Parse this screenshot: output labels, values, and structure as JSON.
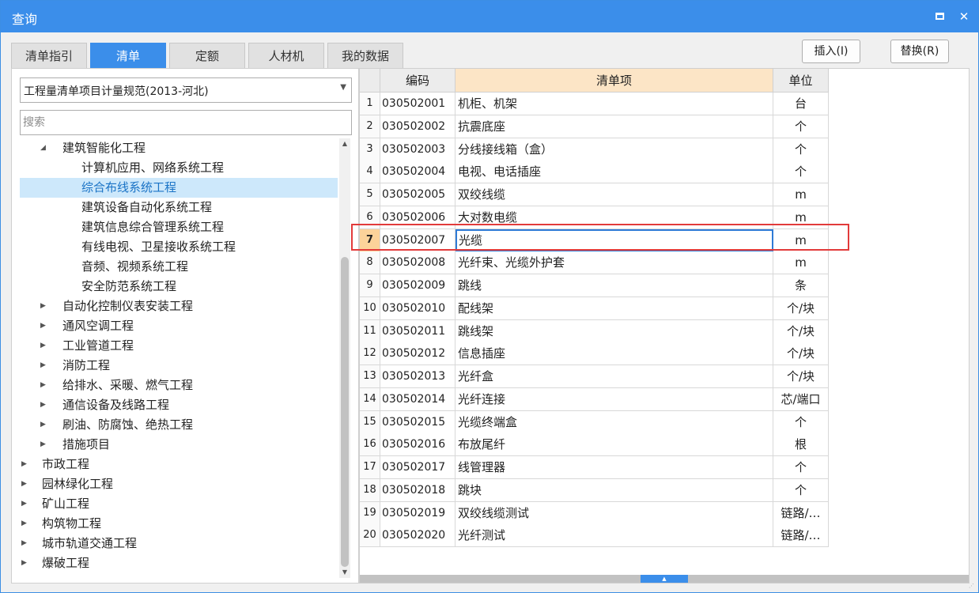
{
  "window": {
    "title": "查询"
  },
  "tabs": [
    "清单指引",
    "清单",
    "定额",
    "人材机",
    "我的数据"
  ],
  "active_tab": 1,
  "buttons": {
    "insert": "插入(I)",
    "replace": "替换(R)"
  },
  "left": {
    "dropdown_value": "工程量清单项目计量规范(2013-河北)",
    "search_placeholder": "搜索",
    "tree": [
      {
        "label": "建筑智能化工程",
        "level": 1,
        "state": "expanded",
        "selected": false
      },
      {
        "label": "计算机应用、网络系统工程",
        "level": 2,
        "state": "leaf",
        "selected": false
      },
      {
        "label": "综合布线系统工程",
        "level": 2,
        "state": "leaf",
        "selected": true
      },
      {
        "label": "建筑设备自动化系统工程",
        "level": 2,
        "state": "leaf",
        "selected": false
      },
      {
        "label": "建筑信息综合管理系统工程",
        "level": 2,
        "state": "leaf",
        "selected": false
      },
      {
        "label": "有线电视、卫星接收系统工程",
        "level": 2,
        "state": "leaf",
        "selected": false
      },
      {
        "label": "音频、视频系统工程",
        "level": 2,
        "state": "leaf",
        "selected": false
      },
      {
        "label": "安全防范系统工程",
        "level": 2,
        "state": "leaf",
        "selected": false
      },
      {
        "label": "自动化控制仪表安装工程",
        "level": 1,
        "state": "collapsed",
        "selected": false
      },
      {
        "label": "通风空调工程",
        "level": 1,
        "state": "collapsed",
        "selected": false
      },
      {
        "label": "工业管道工程",
        "level": 1,
        "state": "collapsed",
        "selected": false
      },
      {
        "label": "消防工程",
        "level": 1,
        "state": "collapsed",
        "selected": false
      },
      {
        "label": "给排水、采暖、燃气工程",
        "level": 1,
        "state": "collapsed",
        "selected": false
      },
      {
        "label": "通信设备及线路工程",
        "level": 1,
        "state": "collapsed",
        "selected": false
      },
      {
        "label": "刷油、防腐蚀、绝热工程",
        "level": 1,
        "state": "collapsed",
        "selected": false
      },
      {
        "label": "措施项目",
        "level": 1,
        "state": "collapsed",
        "selected": false
      },
      {
        "label": "市政工程",
        "level": 0,
        "state": "collapsed",
        "selected": false
      },
      {
        "label": "园林绿化工程",
        "level": 0,
        "state": "collapsed",
        "selected": false
      },
      {
        "label": "矿山工程",
        "level": 0,
        "state": "collapsed",
        "selected": false
      },
      {
        "label": "构筑物工程",
        "level": 0,
        "state": "collapsed",
        "selected": false
      },
      {
        "label": "城市轨道交通工程",
        "level": 0,
        "state": "collapsed",
        "selected": false
      },
      {
        "label": "爆破工程",
        "level": 0,
        "state": "collapsed",
        "selected": false
      }
    ]
  },
  "grid": {
    "headers": {
      "code": "编码",
      "name": "清单项",
      "unit": "单位"
    },
    "active_row": 6,
    "rows": [
      {
        "num": "1",
        "code": "030502001",
        "name": "机柜、机架",
        "unit": "台"
      },
      {
        "num": "2",
        "code": "030502002",
        "name": "抗震底座",
        "unit": "个"
      },
      {
        "num": "3",
        "code": "030502003",
        "name": "分线接线箱（盒）",
        "unit": "个"
      },
      {
        "num": "4",
        "code": "030502004",
        "name": "电视、电话插座",
        "unit": "个"
      },
      {
        "num": "5",
        "code": "030502005",
        "name": "双绞线缆",
        "unit": "m"
      },
      {
        "num": "6",
        "code": "030502006",
        "name": "大对数电缆",
        "unit": "m"
      },
      {
        "num": "7",
        "code": "030502007",
        "name": "光缆",
        "unit": "m"
      },
      {
        "num": "8",
        "code": "030502008",
        "name": "光纤束、光缆外护套",
        "unit": "m"
      },
      {
        "num": "9",
        "code": "030502009",
        "name": "跳线",
        "unit": "条"
      },
      {
        "num": "10",
        "code": "030502010",
        "name": "配线架",
        "unit": "个/块"
      },
      {
        "num": "11",
        "code": "030502011",
        "name": "跳线架",
        "unit": "个/块"
      },
      {
        "num": "12",
        "code": "030502012",
        "name": "信息插座",
        "unit": "个/块"
      },
      {
        "num": "13",
        "code": "030502013",
        "name": "光纤盒",
        "unit": "个/块"
      },
      {
        "num": "14",
        "code": "030502014",
        "name": "光纤连接",
        "unit": "芯/端口"
      },
      {
        "num": "15",
        "code": "030502015",
        "name": "光缆终端盒",
        "unit": "个"
      },
      {
        "num": "16",
        "code": "030502016",
        "name": "布放尾纤",
        "unit": "根"
      },
      {
        "num": "17",
        "code": "030502017",
        "name": "线管理器",
        "unit": "个"
      },
      {
        "num": "18",
        "code": "030502018",
        "name": "跳块",
        "unit": "个"
      },
      {
        "num": "19",
        "code": "030502019",
        "name": "双绞线缆测试",
        "unit": "链路/…"
      },
      {
        "num": "20",
        "code": "030502020",
        "name": "光纤测试",
        "unit": "链路/…"
      }
    ]
  },
  "icons": {
    "maximize": "maximize-icon",
    "close": "close-icon",
    "dropdown": "chevron-down-icon"
  }
}
